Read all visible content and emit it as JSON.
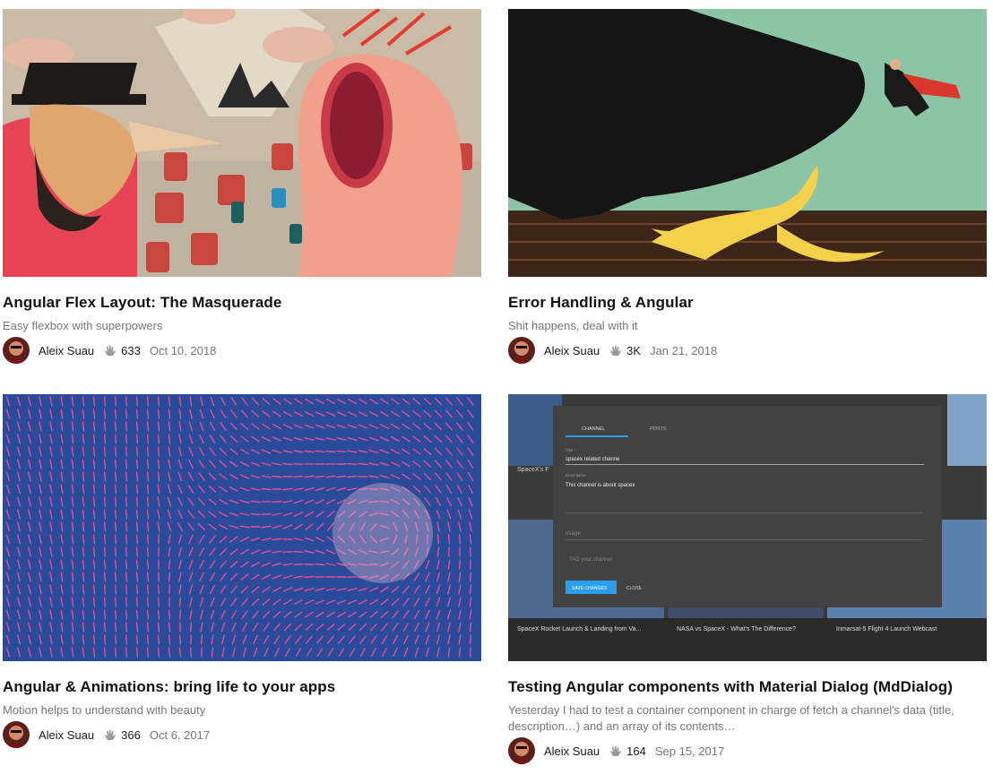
{
  "articles": [
    {
      "title": "Angular Flex Layout: The Masquerade",
      "subtitle": "Easy flexbox with superpowers",
      "author": "Aleix Suau",
      "claps": "633",
      "date": "Oct 10, 2018"
    },
    {
      "title": "Error Handling & Angular",
      "subtitle": "Shit happens, deal with it",
      "author": "Aleix Suau",
      "claps": "3K",
      "date": "Jan 21, 2018"
    },
    {
      "title": "Angular & Animations: bring life to your apps",
      "subtitle": "Motion helps to understand with beauty",
      "author": "Aleix Suau",
      "claps": "366",
      "date": "Oct 6, 2017"
    },
    {
      "title": "Testing Angular components with Material Dialog (MdDialog)",
      "subtitle": "Yesterday I had to test a container component in charge of fetch a channel's data (title, description…) and an array of its contents…",
      "author": "Aleix Suau",
      "claps": "164",
      "date": "Sep 15, 2017"
    }
  ],
  "dialog_screenshot": {
    "tabs": [
      "CHANNEL",
      "POSTS"
    ],
    "title_label": "Title *",
    "title_value": "spacex related channe",
    "description_label": "Description",
    "description_value": "This channel is about spacex",
    "image_label": "Image",
    "tag_placeholder": "TAG your channel",
    "save_label": "SAVE CHANGES",
    "close_label": "CLOSE",
    "bg_cards": [
      "SpaceX's F",
      "SpaceX Rocket Launch & Landing from Va...",
      "NASA vs SpaceX - What's The Difference?",
      "Inmarsat-5 Flight 4 Launch Webcast"
    ]
  },
  "colors": {
    "accent_blue": "#2a9ff0",
    "clap_gray": "#9a9a9a",
    "muted_text": "#767676"
  }
}
